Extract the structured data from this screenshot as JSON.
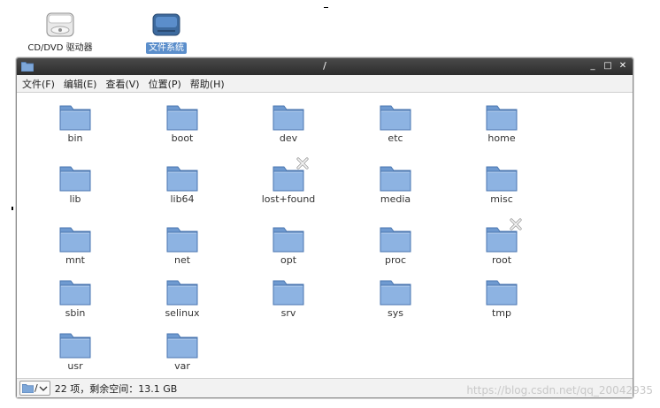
{
  "desktop": {
    "icons": [
      {
        "label": "CD/DVD 驱动器"
      },
      {
        "label": "文件系统"
      }
    ]
  },
  "window": {
    "title": "/",
    "controls": {
      "minimize": "_",
      "maximize": "□",
      "close": "✕"
    }
  },
  "menu": [
    "文件(F)",
    "编辑(E)",
    "查看(V)",
    "位置(P)",
    "帮助(H)"
  ],
  "folders": [
    "bin",
    "boot",
    "dev",
    "etc",
    "home",
    "lib",
    "lib64",
    "lost+found",
    "media",
    "misc",
    "mnt",
    "net",
    "opt",
    "proc",
    "root",
    "sbin",
    "selinux",
    "srv",
    "sys",
    "tmp",
    "usr",
    "var"
  ],
  "status": {
    "path_label": "/",
    "text": "22 项，剩余空间：13.1 GB"
  },
  "watermark": "https://blog.csdn.net/qq_20042935",
  "colors": {
    "accent": "#5b8ecb",
    "folder": "#7ea7d8"
  }
}
